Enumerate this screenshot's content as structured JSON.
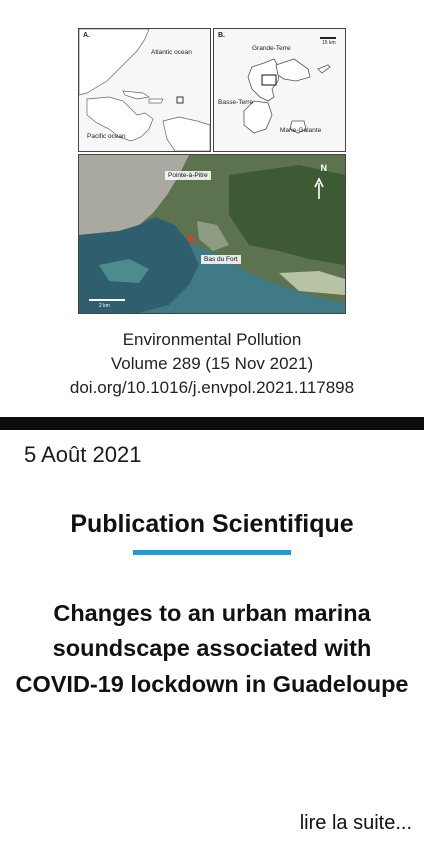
{
  "figure": {
    "panel_a": {
      "label": "A.",
      "atlantic": "Atlantic ocean",
      "pacific": "Pacific ocean"
    },
    "panel_b": {
      "label": "B.",
      "grande_terre": "Grande-Terre",
      "basse_terre": "Basse-Terre",
      "marie_galante": "Marie-Galante",
      "scale": "15 km"
    },
    "panel_c": {
      "pointe_a_pitre": "Pointe-à-Pitre",
      "bas_du_fort": "Bas du Fort",
      "north": "N",
      "scale": "2 km"
    }
  },
  "journal": {
    "name": "Environmental Pollution",
    "volume": "Volume 289 (15 Nov 2021)",
    "doi": "doi.org/10.1016/j.envpol.2021.117898"
  },
  "post": {
    "date": "5 Août 2021",
    "category": "Publication Scientifique",
    "title": "Changes to an urban marina soundscape associated with COVID-19 lockdown in Guadeloupe",
    "read_more": "lire la suite..."
  },
  "colors": {
    "accent": "#1e9ad6",
    "divider": "#0d0d0d"
  }
}
